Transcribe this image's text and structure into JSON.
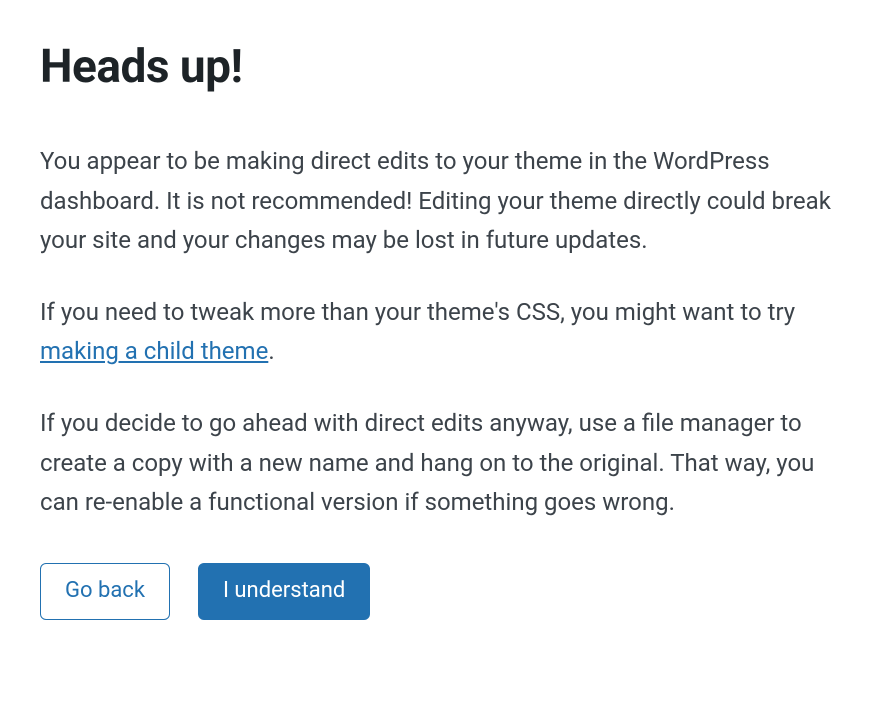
{
  "heading": "Heads up!",
  "paragraph1": "You appear to be making direct edits to your theme in the WordPress dashboard. It is not recommended! Editing your theme directly could break your site and your changes may be lost in future updates.",
  "paragraph2_before": "If you need to tweak more than your theme's CSS, you might want to try ",
  "paragraph2_link": "making a child theme",
  "paragraph2_after": ".",
  "paragraph3": "If you decide to go ahead with direct edits anyway, use a file manager to create a copy with a new name and hang on to the original. That way, you can re-enable a functional version if something goes wrong.",
  "buttons": {
    "back": "Go back",
    "confirm": "I understand"
  },
  "colors": {
    "accent": "#2271b1",
    "text": "#3c434a",
    "heading": "#1d2327"
  }
}
